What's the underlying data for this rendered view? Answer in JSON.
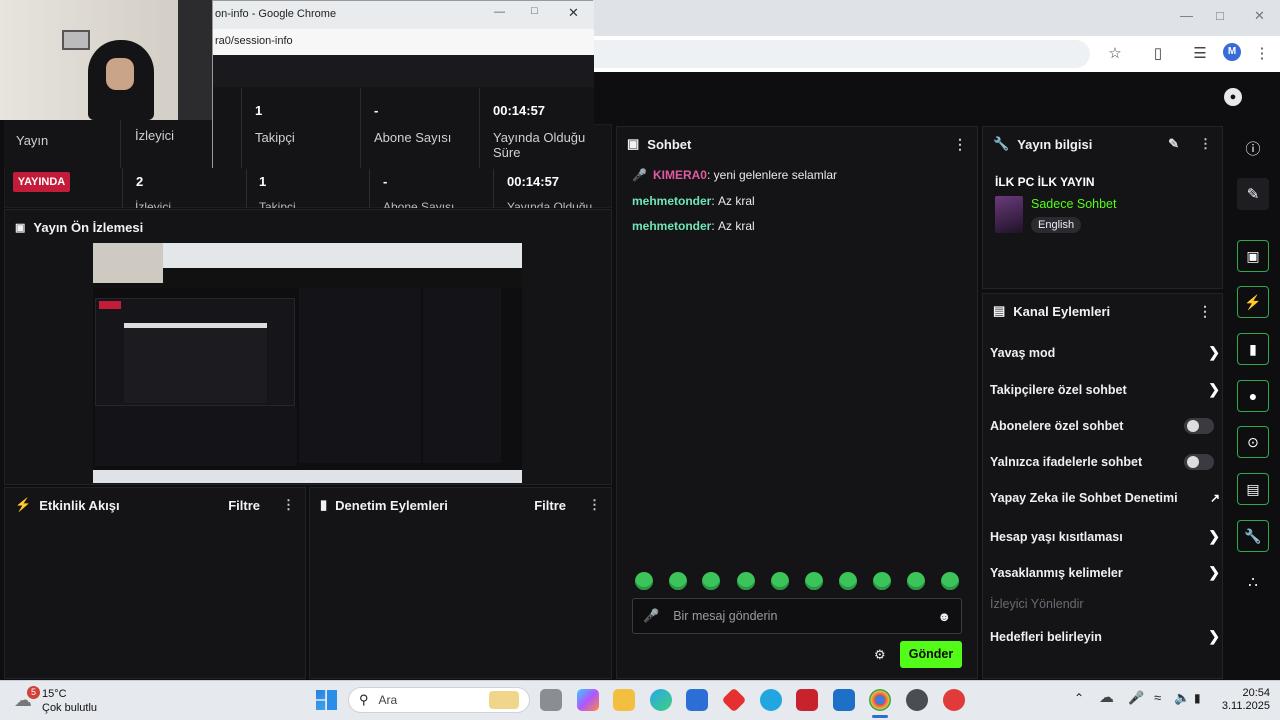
{
  "browser_back": {
    "user_initial": "M"
  },
  "front_window": {
    "title": "on-info - Google Chrome",
    "address": "ra0/session-info",
    "stats_headers": [
      "Yayın",
      "İzleyici"
    ],
    "stats": [
      {
        "value": "1",
        "label": "Takipçi"
      },
      {
        "value": "-",
        "label": "Abone Sayısı"
      },
      {
        "value": "00:14:57",
        "label": "Yayında Olduğu Süre"
      }
    ]
  },
  "stats_row": {
    "live_badge": "YAYINDA",
    "viewers": "2",
    "followers": "1",
    "subs": "-",
    "duration": "00:14:57",
    "cut_labels": [
      "İzleyici",
      "Takipçi",
      "Abone Sayısı",
      "Yayında Olduğu"
    ]
  },
  "preview": {
    "title": "Yayın Ön İzlemesi"
  },
  "events": {
    "title": "Etkinlik Akışı",
    "filter": "Filtre"
  },
  "moderation": {
    "title": "Denetim Eylemleri",
    "filter": "Filtre"
  },
  "chat": {
    "title": "Sohbet",
    "messages": [
      {
        "user": "KIMERA0",
        "text": "yeni gelenlere selamlar",
        "host": true
      },
      {
        "user": "mehmetonder",
        "text": "Az kral",
        "host": false
      },
      {
        "user": "mehmetonder",
        "text": "Az kral",
        "host": false
      }
    ],
    "input_placeholder": "Bir mesaj gönderin",
    "send_label": "Gönder"
  },
  "stream_info": {
    "title": "Yayın bilgisi",
    "stream_title": "İLK PC İLK YAYIN",
    "category": "Sadece Sohbet",
    "language": "English"
  },
  "channel_actions": {
    "title": "Kanal Eylemleri",
    "items": [
      {
        "label": "Yavaş mod",
        "kind": "chevron"
      },
      {
        "label": "Takipçilere özel sohbet",
        "kind": "chevron"
      },
      {
        "label": "Abonelere özel sohbet",
        "kind": "toggle"
      },
      {
        "label": "Yalnızca ifadelerle sohbet",
        "kind": "toggle"
      },
      {
        "label": "Yapay Zeka ile Sohbet Denetimi",
        "kind": "external"
      },
      {
        "label": "Hesap yaşı kısıtlaması",
        "kind": "chevron"
      },
      {
        "label": "Yasaklanmış kelimeler",
        "kind": "chevron"
      },
      {
        "label": "İzleyici Yönlendir",
        "kind": "disabled"
      },
      {
        "label": "Hedefleri belirleyin",
        "kind": "chevron"
      }
    ]
  },
  "taskbar": {
    "weather_temp": "15°C",
    "weather_desc": "Çok bulutlu",
    "weather_badge": "5",
    "search_placeholder": "Ara",
    "time": "20:54",
    "date": "3.11.2025"
  }
}
